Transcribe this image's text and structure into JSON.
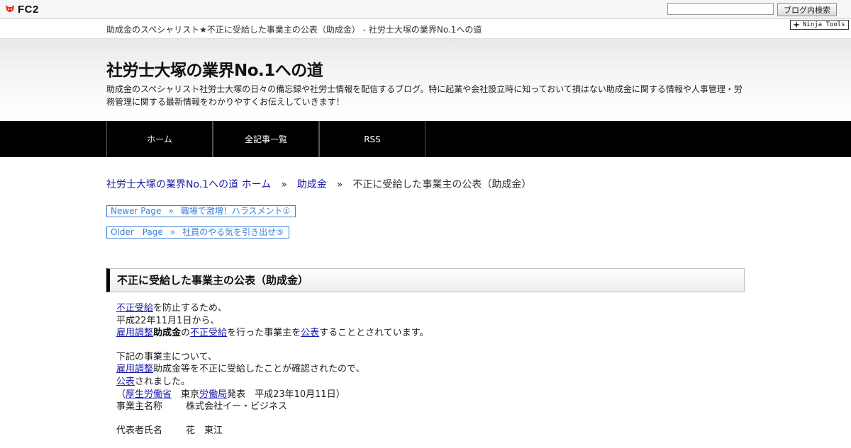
{
  "fc2bar": {
    "logo_text": "FC2",
    "search_placeholder": "",
    "search_button": "ブログ内検索"
  },
  "subhead": {
    "title": "助成金のスペシャリスト★不正に受給した事業主の公表（助成金） - 社労士大塚の業界No.1への道",
    "ninja_label": "Ninja Tools"
  },
  "blog": {
    "title": "社労士大塚の業界No.1への道",
    "description": "助成金のスペシャリスト社労士大塚の日々の備忘録や社労士情報を配信するブログ。特に起業や会社設立時に知っておいて損はない助成金に関する情報や人事管理・労務管理に関する最新情報をわかりやすくお伝えしていきます！"
  },
  "nav": {
    "items": [
      {
        "label": "ホーム"
      },
      {
        "label": "全記事一覧"
      },
      {
        "label": "RSS"
      }
    ]
  },
  "breadcrumb": {
    "home": "社労士大塚の業界No.1への道 ホーム",
    "sep": "»",
    "category": "助成金",
    "current": "不正に受給した事業主の公表（助成金）"
  },
  "pager": {
    "newer_label": "Newer Page",
    "newer_sep": "»",
    "newer_title": "職場で激増！ハラスメント①",
    "older_label": "Older　Page",
    "older_sep": "»",
    "older_title": "社員のやる気を引き出せ⑤"
  },
  "entry": {
    "title": "不正に受給した事業主の公表（助成金）",
    "p1": {
      "l1_link": "不正受給",
      "l1_text": "を防止するため、",
      "l2": "平成22年11月1日から、",
      "l3_link1": "雇用調整",
      "l3_bold": "助成金",
      "l3_text1": "の",
      "l3_link2": "不正受給",
      "l3_text2": "を行った事業主を",
      "l3_link3": "公表",
      "l3_text3": "することとされています。"
    },
    "p2": {
      "l1": "下記の事業主について、",
      "l2_link": "雇用調整",
      "l2_text": "助成金等を不正に受給したことが確認されたので、",
      "l3_link": "公表",
      "l3_text": "されました。",
      "l4_pre": "（",
      "l4_link1": "厚生労働省",
      "l4_mid": "　東京",
      "l4_link2": "労働局",
      "l4_text": "発表　平成23年10月11日）",
      "l5_label": "事業主名称",
      "l5_value": "株式会社イー・ビジネス"
    },
    "p3": {
      "l1_label": "代表者氏名",
      "l1_value": "花　東江"
    }
  }
}
